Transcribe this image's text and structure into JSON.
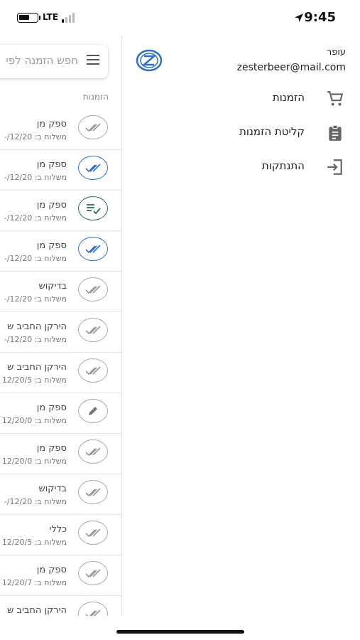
{
  "status_bar": {
    "carrier": "LTE",
    "time": "9:45"
  },
  "orders_list": {
    "search_placeholder": "חפש הזמנה לפי",
    "section_header": "הזמנות",
    "rows": [
      {
        "title": "ספק מן",
        "subtitle": "משלוח ב: 12/20/-",
        "status_icon": "double-check-icon",
        "status": "gray"
      },
      {
        "title": "ספק מן",
        "subtitle": "משלוח ב: 12/20/-",
        "status_icon": "double-check-icon",
        "status": "blue"
      },
      {
        "title": "ספק מן",
        "subtitle": "משלוח ב: 12/20/-",
        "status_icon": "list-check-icon",
        "status": "green"
      },
      {
        "title": "ספק מן",
        "subtitle": "משלוח ב: 12/20/-",
        "status_icon": "double-check-icon",
        "status": "blue"
      },
      {
        "title": "בדיקוש",
        "subtitle": "משלוח ב: 12/20/-",
        "status_icon": "double-check-icon",
        "status": "gray"
      },
      {
        "title": "הירקן החביב ש",
        "subtitle": "משלוח ב: 12/20/-",
        "status_icon": "double-check-icon",
        "status": "gray"
      },
      {
        "title": "הירקן החביב ש",
        "subtitle": "משלוח ב: 12/20/5",
        "status_icon": "double-check-icon",
        "status": "gray"
      },
      {
        "title": "ספק מן",
        "subtitle": "משלוח ב: 12/20/0",
        "status_icon": "pencil-icon",
        "status": "gray"
      },
      {
        "title": "ספק מן",
        "subtitle": "משלוח ב: 12/20/0",
        "status_icon": "double-check-icon",
        "status": "gray"
      },
      {
        "title": "בדיקוש",
        "subtitle": "משלוח ב: 12/20/-",
        "status_icon": "double-check-icon",
        "status": "gray"
      },
      {
        "title": "כללי",
        "subtitle": "משלוח ב: 12/20/5",
        "status_icon": "double-check-icon",
        "status": "gray"
      },
      {
        "title": "ספק מן",
        "subtitle": "משלוח ב: 12/20/7",
        "status_icon": "double-check-icon",
        "status": "gray"
      },
      {
        "title": "הירקן החביב ש",
        "subtitle": "",
        "status_icon": "double-check-icon",
        "status": "gray"
      }
    ]
  },
  "drawer": {
    "user_name": "עופר",
    "user_email": "zesterbeer@mail.com",
    "items": [
      {
        "label": "הזמנות",
        "icon": "cart-icon"
      },
      {
        "label": "קליטת הזמנות",
        "icon": "clipboard-icon"
      },
      {
        "label": "התנתקות",
        "icon": "logout-icon"
      }
    ]
  },
  "colors": {
    "accent_blue": "#2f6fc0",
    "status_green": "#2e6b52",
    "icon_gray": "#666666"
  }
}
